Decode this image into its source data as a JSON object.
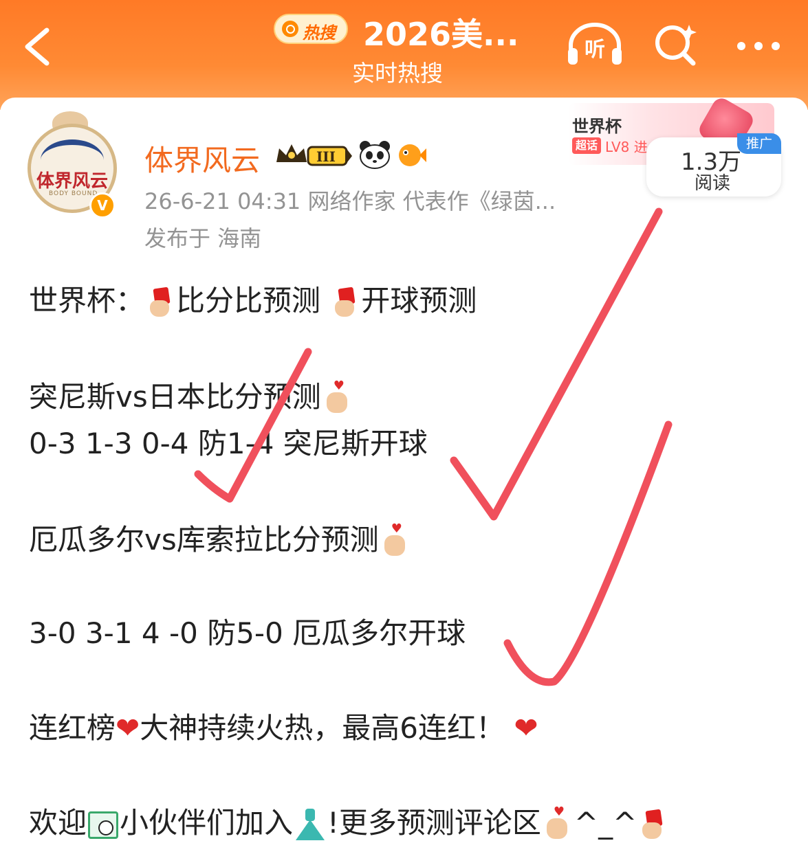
{
  "header": {
    "hot_search_badge": "热搜",
    "title": "2026美...",
    "subtitle": "实时热搜",
    "icons": [
      "back-arrow-icon",
      "listen-icon",
      "search-icon",
      "more-icon"
    ],
    "listen_label": "听",
    "accent_color": "#ff7a26"
  },
  "post": {
    "author": {
      "name": "体界风云",
      "avatar_text": "体界风云",
      "avatar_subtext": "BODY BOUND",
      "verified_mark": "V",
      "level_badge": "III"
    },
    "meta": "26-6-21 04:31  网络作家 代表作《绿茵...",
    "location": "发布于 海南",
    "promo": {
      "title": "世界杯",
      "tag": "超话",
      "level": "LV8 进",
      "read_count": "1.3万",
      "read_label": "阅读",
      "ad_label": "推广"
    },
    "body": {
      "line1_a": "世界杯：",
      "line1_b": "比分比预测",
      "line1_c": "开球预测",
      "line2": "突尼斯vs日本比分预测",
      "line3": "0-3   1-3   0-4  防1-4  突尼斯开球",
      "line4": "厄瓜多尔vs库索拉比分预测",
      "line5": "3-0    3-1    4 -0 防5-0  厄瓜多尔开球",
      "line6_a": "连红榜",
      "line6_b": "大神持续火热，最高6连红！",
      "line7_a": "欢迎",
      "line7_b": "小伙伴们加入",
      "line7_c": "!更多预测评论区",
      "line7_d": "^_^"
    }
  },
  "colors": {
    "checkmark": "#f0505c",
    "name": "#f26a1f",
    "meta": "#939393"
  }
}
